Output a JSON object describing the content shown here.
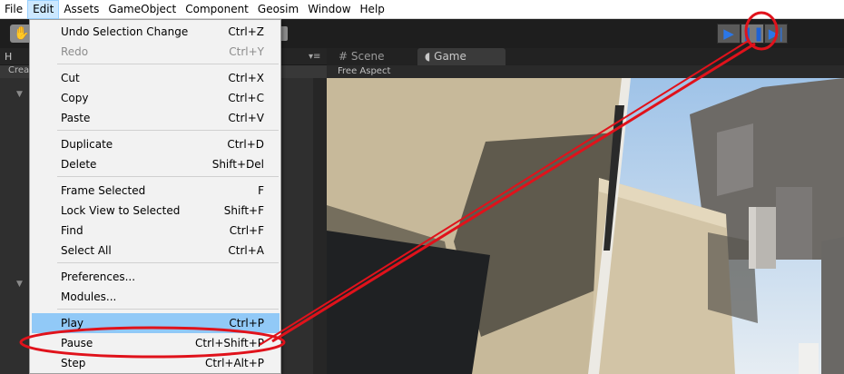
{
  "menubar": {
    "items": [
      {
        "label": "File"
      },
      {
        "label": "Edit"
      },
      {
        "label": "Assets"
      },
      {
        "label": "GameObject"
      },
      {
        "label": "Component"
      },
      {
        "label": "Geosim"
      },
      {
        "label": "Window"
      },
      {
        "label": "Help"
      }
    ]
  },
  "hierarchy": {
    "tab_label": "H",
    "create_label": "Crea"
  },
  "views": {
    "scene_label": "Scene",
    "game_label": "Game",
    "aspect_label": "Free Aspect"
  },
  "edit_menu": {
    "items": [
      {
        "label": "Undo Selection Change",
        "shortcut": "Ctrl+Z"
      },
      {
        "label": "Redo",
        "shortcut": "Ctrl+Y"
      },
      {
        "label": "Cut",
        "shortcut": "Ctrl+X"
      },
      {
        "label": "Copy",
        "shortcut": "Ctrl+C"
      },
      {
        "label": "Paste",
        "shortcut": "Ctrl+V"
      },
      {
        "label": "Duplicate",
        "shortcut": "Ctrl+D"
      },
      {
        "label": "Delete",
        "shortcut": "Shift+Del"
      },
      {
        "label": "Frame Selected",
        "shortcut": "F"
      },
      {
        "label": "Lock View to Selected",
        "shortcut": "Shift+F"
      },
      {
        "label": "Find",
        "shortcut": "Ctrl+F"
      },
      {
        "label": "Select All",
        "shortcut": "Ctrl+A"
      },
      {
        "label": "Preferences...",
        "shortcut": ""
      },
      {
        "label": "Modules...",
        "shortcut": ""
      },
      {
        "label": "Play",
        "shortcut": "Ctrl+P"
      },
      {
        "label": "Pause",
        "shortcut": "Ctrl+Shift+P"
      },
      {
        "label": "Step",
        "shortcut": "Ctrl+Alt+P"
      }
    ]
  },
  "colors": {
    "highlight": "#91c9f7",
    "annotation_red": "#e0121b",
    "play_blue": "#2b77e8"
  },
  "icons": {
    "hand_tool": "hand-icon",
    "play": "play-icon",
    "pause": "pause-icon",
    "step": "step-icon"
  }
}
